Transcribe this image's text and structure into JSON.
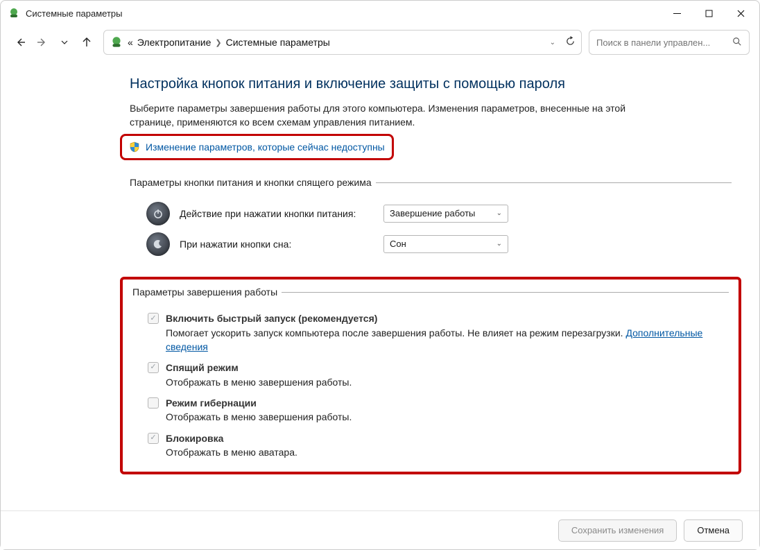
{
  "window": {
    "title": "Системные параметры"
  },
  "nav": {
    "breadcrumb": {
      "prefix": "«",
      "item1": "Электропитание",
      "item2": "Системные параметры"
    },
    "search_placeholder": "Поиск в панели управлен..."
  },
  "page": {
    "heading": "Настройка кнопок питания и включение защиты с помощью пароля",
    "intro": "Выберите параметры завершения работы для этого компьютера. Изменения параметров, внесенные на этой странице, применяются ко всем схемам управления питанием.",
    "unlock_link": "Изменение параметров, которые сейчас недоступны"
  },
  "power_buttons": {
    "legend": "Параметры кнопки питания и кнопки спящего режима",
    "power_label": "Действие при нажатии кнопки питания:",
    "power_value": "Завершение работы",
    "sleep_label": "При нажатии кнопки сна:",
    "sleep_value": "Сон"
  },
  "shutdown": {
    "legend": "Параметры завершения работы",
    "items": [
      {
        "title": "Включить быстрый запуск (рекомендуется)",
        "desc": "Помогает ускорить запуск компьютера после завершения работы. Не влияет на режим перезагрузки.",
        "more": "Дополнительные сведения",
        "checked": true
      },
      {
        "title": "Спящий режим",
        "desc": "Отображать в меню завершения работы.",
        "checked": true
      },
      {
        "title": "Режим гибернации",
        "desc": "Отображать в меню завершения работы.",
        "checked": false
      },
      {
        "title": "Блокировка",
        "desc": "Отображать в меню аватара.",
        "checked": true
      }
    ]
  },
  "footer": {
    "save": "Сохранить изменения",
    "cancel": "Отмена"
  }
}
